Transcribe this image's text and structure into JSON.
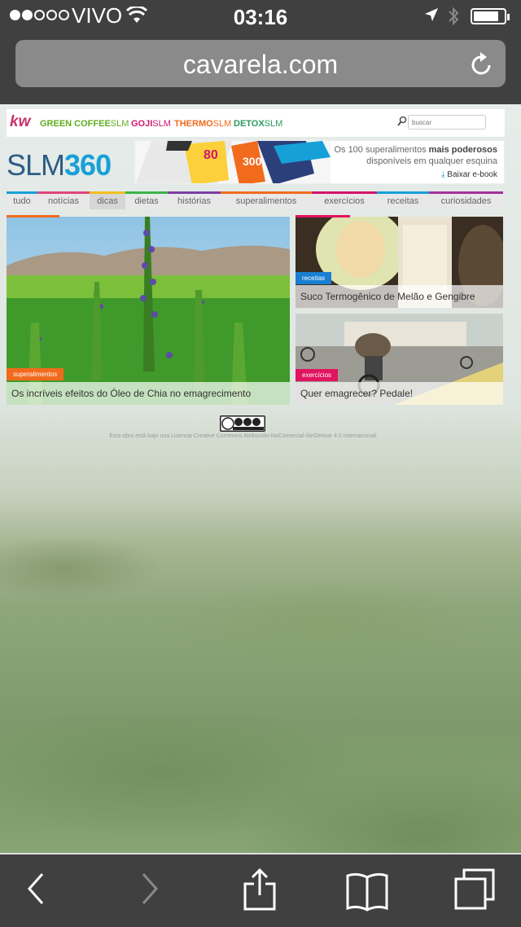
{
  "status": {
    "carrier": "VIVO",
    "time": "03:16",
    "signal_bars": 2,
    "signal_total": 5,
    "battery_level": 0.75
  },
  "browser": {
    "url": "cavarela.com"
  },
  "site": {
    "brands": [
      {
        "bold": "GREEN COFFEE",
        "light": "SLM",
        "color": "#5fae1e"
      },
      {
        "bold": "GOJI",
        "light": "SLM",
        "color": "#d1156d"
      },
      {
        "bold": "THERMO",
        "light": "SLM",
        "color": "#f26b1d"
      },
      {
        "bold": "DETOX",
        "light": "SLM",
        "color": "#2b9a5e"
      }
    ],
    "search_placeholder": "buscar",
    "logo_slm": "SLM",
    "logo_num": "360",
    "banner": {
      "line1": "Os 100 superalimentos",
      "line1_bold": "mais poderosos",
      "line2": "disponíveis em qualquer esquina",
      "ebook_label": "Baixar e-book"
    },
    "nav": [
      {
        "label": "tudo",
        "color": "#17a0d8"
      },
      {
        "label": "notícias",
        "color": "#e0457b"
      },
      {
        "label": "dicas",
        "color": "#f0c020"
      },
      {
        "label": "dietas",
        "color": "#3cb44b"
      },
      {
        "label": "histórias",
        "color": "#7b3fa0"
      },
      {
        "label": "superalimentos",
        "color": "#f26b1d"
      },
      {
        "label": "exercícios",
        "color": "#d1156d"
      },
      {
        "label": "receitas",
        "color": "#17a0d8"
      },
      {
        "label": "curiosidades",
        "color": "#a3329a"
      }
    ],
    "articles": [
      {
        "tag": "superalimentos",
        "title": "Os incríveis efeitos do Óleo de Chia no emagrecimento",
        "tag_color": "#f26b1d"
      },
      {
        "tag": "receitas",
        "title": "Suco Termogênico de Melão e Gengibre",
        "tag_color": "#1a7fd1"
      },
      {
        "tag": "exercícios",
        "title": "Quer emagrecer? Pedale!",
        "tag_color": "#e0145f"
      }
    ],
    "license_text": "Esta obra está bajo una Licencia Creative Commons Atribución-NoComercial-SinDerivar 4.0 Internacional."
  }
}
